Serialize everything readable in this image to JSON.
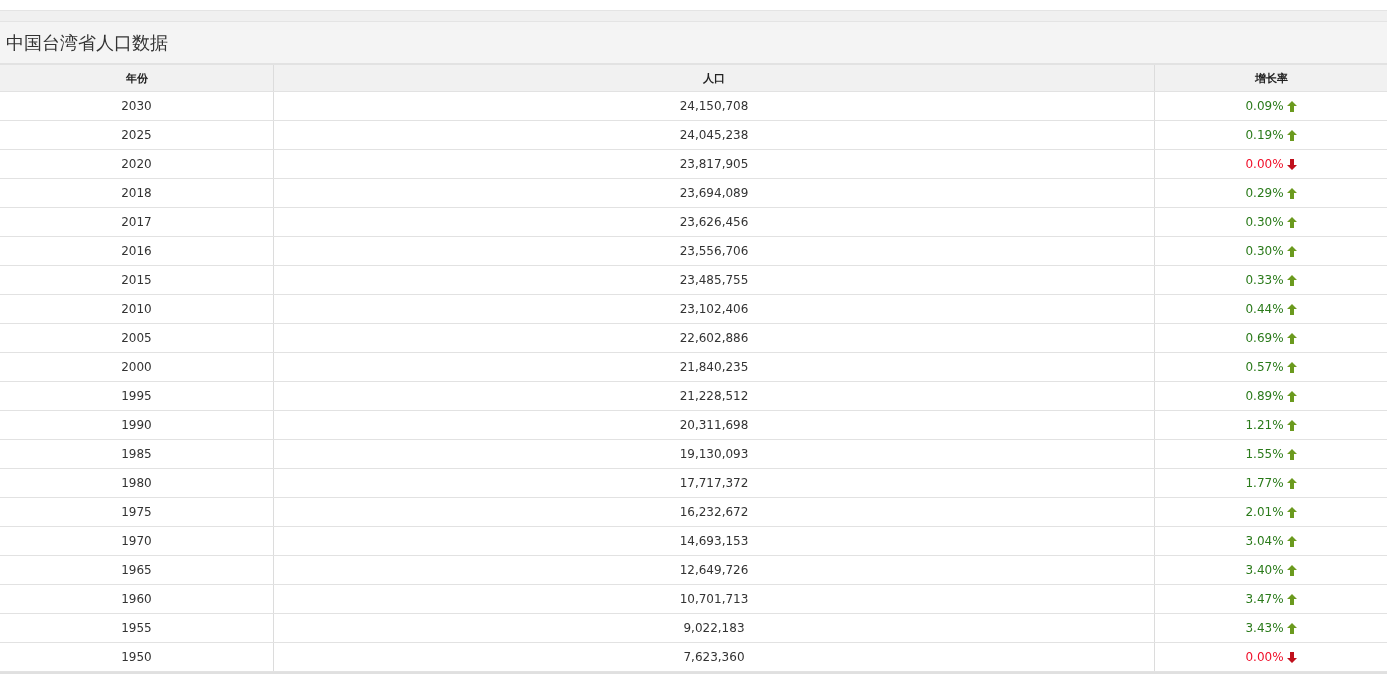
{
  "title": "中国台湾省人口数据",
  "columns": [
    "年份",
    "人口",
    "增长率"
  ],
  "rows": [
    {
      "year": "2030",
      "population": "24,150,708",
      "rate": "0.09%",
      "rising": true
    },
    {
      "year": "2025",
      "population": "24,045,238",
      "rate": "0.19%",
      "rising": true
    },
    {
      "year": "2020",
      "population": "23,817,905",
      "rate": "0.00%",
      "rising": false
    },
    {
      "year": "2018",
      "population": "23,694,089",
      "rate": "0.29%",
      "rising": true
    },
    {
      "year": "2017",
      "population": "23,626,456",
      "rate": "0.30%",
      "rising": true
    },
    {
      "year": "2016",
      "population": "23,556,706",
      "rate": "0.30%",
      "rising": true
    },
    {
      "year": "2015",
      "population": "23,485,755",
      "rate": "0.33%",
      "rising": true
    },
    {
      "year": "2010",
      "population": "23,102,406",
      "rate": "0.44%",
      "rising": true
    },
    {
      "year": "2005",
      "population": "22,602,886",
      "rate": "0.69%",
      "rising": true
    },
    {
      "year": "2000",
      "population": "21,840,235",
      "rate": "0.57%",
      "rising": true
    },
    {
      "year": "1995",
      "population": "21,228,512",
      "rate": "0.89%",
      "rising": true
    },
    {
      "year": "1990",
      "population": "20,311,698",
      "rate": "1.21%",
      "rising": true
    },
    {
      "year": "1985",
      "population": "19,130,093",
      "rate": "1.55%",
      "rising": true
    },
    {
      "year": "1980",
      "population": "17,717,372",
      "rate": "1.77%",
      "rising": true
    },
    {
      "year": "1975",
      "population": "16,232,672",
      "rate": "2.01%",
      "rising": true
    },
    {
      "year": "1970",
      "population": "14,693,153",
      "rate": "3.04%",
      "rising": true
    },
    {
      "year": "1965",
      "population": "12,649,726",
      "rate": "3.40%",
      "rising": true
    },
    {
      "year": "1960",
      "population": "10,701,713",
      "rate": "3.47%",
      "rising": true
    },
    {
      "year": "1955",
      "population": "9,022,183",
      "rate": "3.43%",
      "rising": true
    },
    {
      "year": "1950",
      "population": "7,623,360",
      "rate": "0.00%",
      "rising": false
    }
  ]
}
